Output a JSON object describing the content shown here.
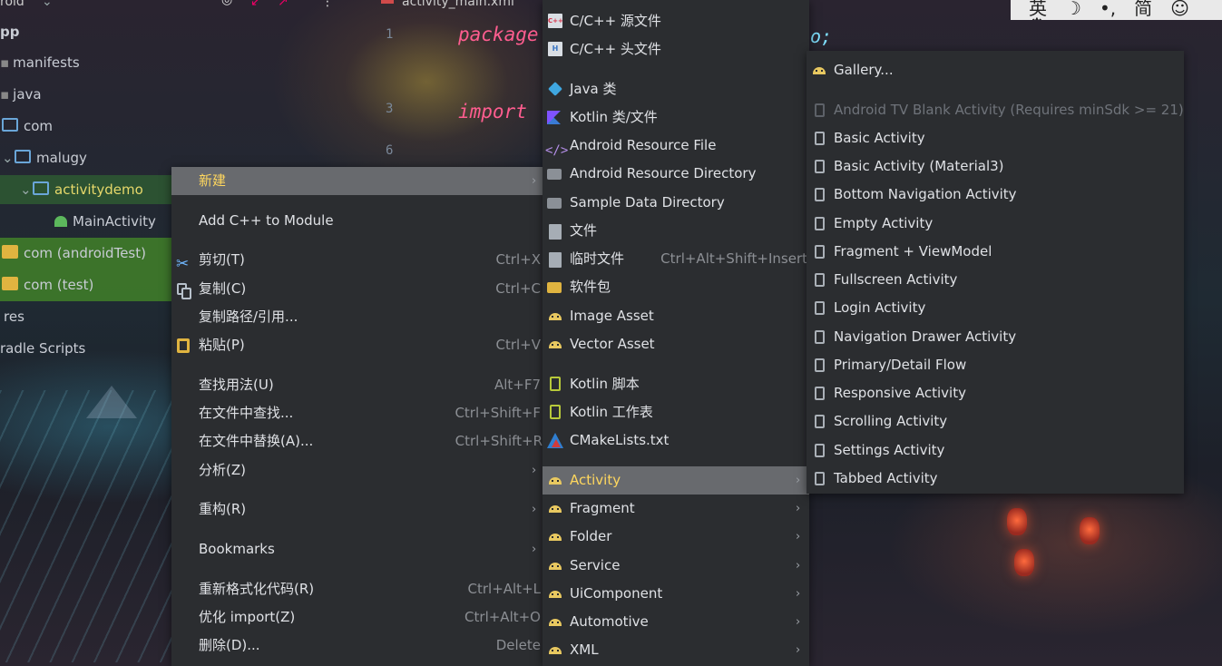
{
  "window": {
    "top_left_text": "roid",
    "editor_tab": "activity_main.xml",
    "code_package": "package",
    "code_import": "import",
    "code_fragment": "o;",
    "gutter": [
      "1",
      "3",
      "6"
    ]
  },
  "ime_bar": {
    "items": [
      "英",
      "☽",
      "•,",
      "简",
      "☺",
      "⚙"
    ]
  },
  "project_tree": [
    {
      "label": "pp",
      "indent": 0
    },
    {
      "label": "manifests",
      "indent": 0
    },
    {
      "label": "java",
      "indent": 0
    },
    {
      "label": "com",
      "indent": 1
    },
    {
      "label": "malugy",
      "indent": 1
    },
    {
      "label": "activitydemo",
      "indent": 2
    },
    {
      "label": "MainActivity",
      "indent": 3
    },
    {
      "label": "com (androidTest)",
      "indent": 0
    },
    {
      "label": "com (test)",
      "indent": 0
    },
    {
      "label": "res",
      "indent": 0
    },
    {
      "label": "radle Scripts",
      "indent": 0
    }
  ],
  "context_menu": {
    "items": [
      {
        "label": "新建",
        "shortcut": "",
        "has_submenu": true,
        "highlighted": true
      },
      {
        "label": "Add C++ to Module",
        "shortcut": ""
      },
      {
        "label": "剪切(T)",
        "shortcut": "Ctrl+X"
      },
      {
        "label": "复制(C)",
        "shortcut": "Ctrl+C"
      },
      {
        "label": "复制路径/引用...",
        "shortcut": ""
      },
      {
        "label": "粘贴(P)",
        "shortcut": "Ctrl+V"
      },
      {
        "label": "查找用法(U)",
        "shortcut": "Alt+F7"
      },
      {
        "label": "在文件中查找...",
        "shortcut": "Ctrl+Shift+F"
      },
      {
        "label": "在文件中替换(A)...",
        "shortcut": "Ctrl+Shift+R"
      },
      {
        "label": "分析(Z)",
        "shortcut": "",
        "has_submenu": true
      },
      {
        "label": "重构(R)",
        "shortcut": "",
        "has_submenu": true
      },
      {
        "label": "Bookmarks",
        "shortcut": "",
        "has_submenu": true
      },
      {
        "label": "重新格式化代码(R)",
        "shortcut": "Ctrl+Alt+L"
      },
      {
        "label": "优化 import(Z)",
        "shortcut": "Ctrl+Alt+O"
      },
      {
        "label": "删除(D)...",
        "shortcut": "Delete"
      }
    ]
  },
  "new_submenu": {
    "items": [
      {
        "label": "C/C++ 源文件",
        "icon": "cpp-source-icon"
      },
      {
        "label": "C/C++ 头文件",
        "icon": "cpp-header-icon"
      },
      {
        "label": "Java 类",
        "icon": "java-class-icon"
      },
      {
        "label": "Kotlin 类/文件",
        "icon": "kotlin-icon"
      },
      {
        "label": "Android Resource File",
        "icon": "resource-file-icon"
      },
      {
        "label": "Android Resource Directory",
        "icon": "folder-icon"
      },
      {
        "label": "Sample Data Directory",
        "icon": "folder-icon"
      },
      {
        "label": "文件",
        "icon": "file-icon"
      },
      {
        "label": "临时文件",
        "shortcut": "Ctrl+Alt+Shift+Insert",
        "icon": "scratch-file-icon"
      },
      {
        "label": "软件包",
        "icon": "package-icon"
      },
      {
        "label": "Image Asset",
        "icon": "android-icon"
      },
      {
        "label": "Vector Asset",
        "icon": "android-icon"
      },
      {
        "label": "Kotlin 脚本",
        "icon": "kotlin-script-icon"
      },
      {
        "label": "Kotlin 工作表",
        "icon": "kotlin-worksheet-icon"
      },
      {
        "label": "CMakeLists.txt",
        "icon": "cmake-icon"
      },
      {
        "label": "Activity",
        "icon": "android-icon",
        "has_submenu": true,
        "highlighted": true
      },
      {
        "label": "Fragment",
        "icon": "android-icon",
        "has_submenu": true
      },
      {
        "label": "Folder",
        "icon": "android-icon",
        "has_submenu": true
      },
      {
        "label": "Service",
        "icon": "android-icon",
        "has_submenu": true
      },
      {
        "label": "UiComponent",
        "icon": "android-icon",
        "has_submenu": true
      },
      {
        "label": "Automotive",
        "icon": "android-icon",
        "has_submenu": true
      },
      {
        "label": "XML",
        "icon": "android-icon",
        "has_submenu": true
      }
    ]
  },
  "activity_submenu": {
    "items": [
      {
        "label": "Gallery...",
        "icon": "android-icon"
      },
      {
        "label": "Android TV Blank Activity (Requires minSdk >= 21)",
        "disabled": true
      },
      {
        "label": "Basic Activity"
      },
      {
        "label": "Basic Activity (Material3)"
      },
      {
        "label": "Bottom Navigation Activity"
      },
      {
        "label": "Empty Activity"
      },
      {
        "label": "Fragment + ViewModel"
      },
      {
        "label": "Fullscreen Activity"
      },
      {
        "label": "Login Activity"
      },
      {
        "label": "Navigation Drawer Activity"
      },
      {
        "label": "Primary/Detail Flow"
      },
      {
        "label": "Responsive Activity"
      },
      {
        "label": "Scrolling Activity"
      },
      {
        "label": "Settings Activity"
      },
      {
        "label": "Tabbed Activity"
      }
    ]
  },
  "colors": {
    "menu_bg": "#2b2d30",
    "highlight_bg": "#686a6e",
    "highlight_text": "#ffd75e",
    "android_icon": "#e8c860"
  }
}
